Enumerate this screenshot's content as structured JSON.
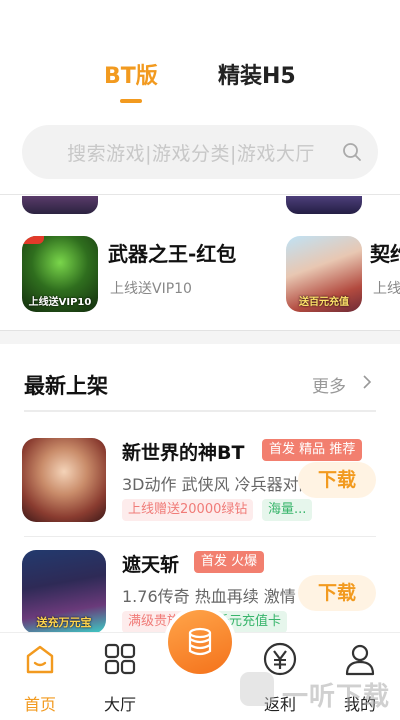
{
  "header": {
    "tabs": [
      {
        "label": "BT版",
        "active": true
      },
      {
        "label": "精装H5",
        "active": false
      }
    ]
  },
  "search": {
    "placeholder": "搜索游戏|游戏分类|游戏大厅"
  },
  "featured": [
    {
      "title": "武器之王-红包",
      "subtitle": "上线送VIP10",
      "thumb_text": "上线送VIP10",
      "icon": "game-thumbnail"
    },
    {
      "title": "契约",
      "subtitle": "上线",
      "thumb_text": "送百元充值",
      "icon": "game-thumbnail"
    }
  ],
  "latest": {
    "title": "最新上架",
    "more_label": "更多",
    "items": [
      {
        "title": "新世界的神BT",
        "badges": [
          "首发",
          "精品",
          "推荐"
        ],
        "description": "3D动作 武侠风 冷兵器对战",
        "tags": [
          {
            "text": "上线赠送20000绿钻",
            "color": "red"
          },
          {
            "text": "海量...",
            "color": "green"
          }
        ],
        "button": "下载"
      },
      {
        "title": "遮天斩",
        "badges": [
          "首发",
          "火爆"
        ],
        "description": "1.76传奇 热血再续 激情",
        "thumb_text": "送充万元宝",
        "tags": [
          {
            "text": "满级贵族vip",
            "color": "red"
          },
          {
            "text": "千元充值卡",
            "color": "green"
          }
        ],
        "button": "下载"
      }
    ]
  },
  "bottom_nav": {
    "items": [
      {
        "label": "首页",
        "icon": "home-icon",
        "active": true
      },
      {
        "label": "大厅",
        "icon": "grid-icon",
        "active": false
      },
      {
        "label": "",
        "icon": "coins-icon",
        "active": false
      },
      {
        "label": "返利",
        "icon": "yen-icon",
        "active": false
      },
      {
        "label": "我的",
        "icon": "user-icon",
        "active": false
      }
    ]
  },
  "watermark": "一听下载",
  "colors": {
    "accent": "#f29a1f",
    "badge": "#f27f6f",
    "tag_red": "#f07b78",
    "tag_green": "#38b56b"
  }
}
